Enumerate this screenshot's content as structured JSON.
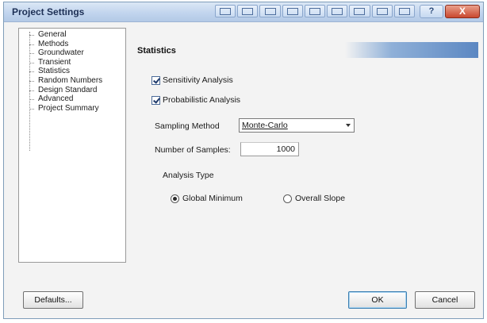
{
  "window": {
    "title": "Project Settings"
  },
  "titlebar": {
    "help_label": "?",
    "close_label": "X"
  },
  "nav": {
    "items": [
      {
        "label": "General"
      },
      {
        "label": "Methods"
      },
      {
        "label": "Groundwater"
      },
      {
        "label": "Transient"
      },
      {
        "label": "Statistics"
      },
      {
        "label": "Random Numbers"
      },
      {
        "label": "Design Standard"
      },
      {
        "label": "Advanced"
      },
      {
        "label": "Project Summary"
      }
    ]
  },
  "panel": {
    "title": "Statistics",
    "sensitivity_label": "Sensitivity Analysis",
    "probabilistic_label": "Probabilistic Analysis",
    "sampling_method_label": "Sampling Method",
    "sampling_method_value": "Monte-Carlo",
    "num_samples_label": "Number of Samples:",
    "num_samples_value": "1000",
    "analysis_type_label": "Analysis Type",
    "radio_global_label": "Global Minimum",
    "radio_overall_label": "Overall Slope"
  },
  "buttons": {
    "defaults": "Defaults...",
    "ok": "OK",
    "cancel": "Cancel"
  },
  "colors": {
    "titlebar": "#c2d5ee",
    "close": "#c9482f",
    "accent": "#5b87c2"
  }
}
